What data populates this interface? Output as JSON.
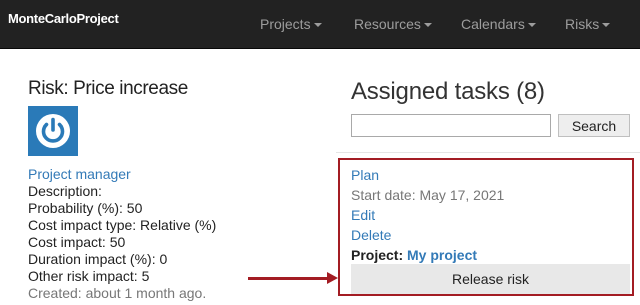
{
  "navbar": {
    "brand": "MonteCarloProject",
    "items": [
      {
        "label": "Projects"
      },
      {
        "label": "Resources"
      },
      {
        "label": "Calendars"
      },
      {
        "label": "Risks"
      }
    ]
  },
  "risk": {
    "title": "Risk: Price increase",
    "icon": "power-icon",
    "owner_link": "Project manager",
    "description": "Description:",
    "probability": "Probability (%): 50",
    "cost_impact_type": "Cost impact type: Relative (%)",
    "cost_impact": "Cost impact: 50",
    "duration_impact": "Duration impact (%): 0",
    "other_risk_impact": "Other risk impact: 5",
    "created": "Created: about 1 month ago."
  },
  "assigned": {
    "title": "Assigned tasks (8)",
    "search_value": "",
    "search_button": "Search",
    "task": {
      "name": "Plan",
      "start_date": "Start date: May 17, 2021",
      "edit": "Edit",
      "delete": "Delete",
      "project_label": "Project:",
      "project_link": "My project",
      "release_button": "Release risk"
    }
  },
  "colors": {
    "navbar": "#222222",
    "link": "#337ab7",
    "highlight": "#a31c23",
    "icon_bg": "#2a7ab8"
  }
}
